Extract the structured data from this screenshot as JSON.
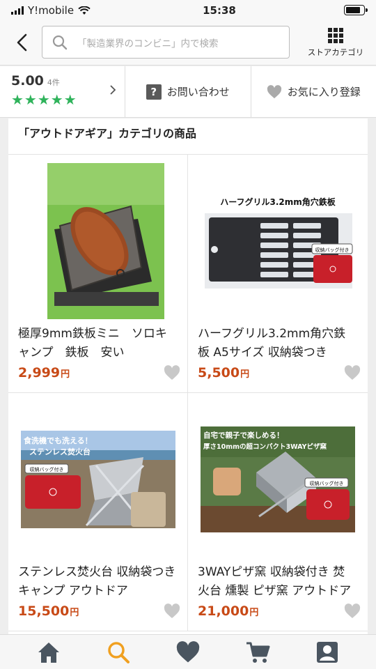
{
  "status_bar": {
    "carrier": "Y!mobile",
    "time": "15:38",
    "battery_level": 0.85
  },
  "header": {
    "search_placeholder": "「製造業界のコンビニ」内で検索",
    "store_category_label": "ストアカテゴリ"
  },
  "shop_bar": {
    "rating_score": "5.00",
    "review_count": "4件",
    "stars": "★★★★★",
    "inquiry_label": "お問い合わせ",
    "favorite_label": "お気に入り登録"
  },
  "section": {
    "title": "「アウトドアギア」カテゴリの商品"
  },
  "products": [
    {
      "name": "極厚9mm鉄板ミニ　ソロキャンプ　鉄板　安い",
      "price": "2,999",
      "currency": "円"
    },
    {
      "name": "ハーフグリル3.2mm角穴鉄板 A5サイズ 収納袋つき",
      "price": "5,500",
      "currency": "円",
      "image_title": "ハーフグリル3.2mm角穴鉄板",
      "image_badge": "収納バッグ付き"
    },
    {
      "name": "ステンレス焚火台 収納袋つき キャンプ アウトドア",
      "price": "15,500",
      "currency": "円",
      "image_title_1": "食洗機でも洗える！",
      "image_title_2": "ステンレス焚火台",
      "image_badge": "収納バッグ付き"
    },
    {
      "name": "3WAYピザ窯 収納袋付き 焚火台 燻製 ピザ窯 アウトドア",
      "price": "21,000",
      "currency": "円",
      "image_title_1": "自宅で親子で楽しめる！",
      "image_title_2": "厚さ10mmの超コンパクト3WAYピザ窯",
      "image_badge": "収納バッグ付き"
    }
  ],
  "colors": {
    "price": "#c84a17",
    "stars": "#2fb35b",
    "search_active": "#f0a020"
  },
  "bottom_nav": [
    "home-icon",
    "search-icon",
    "heart-icon",
    "cart-icon",
    "account-icon"
  ]
}
